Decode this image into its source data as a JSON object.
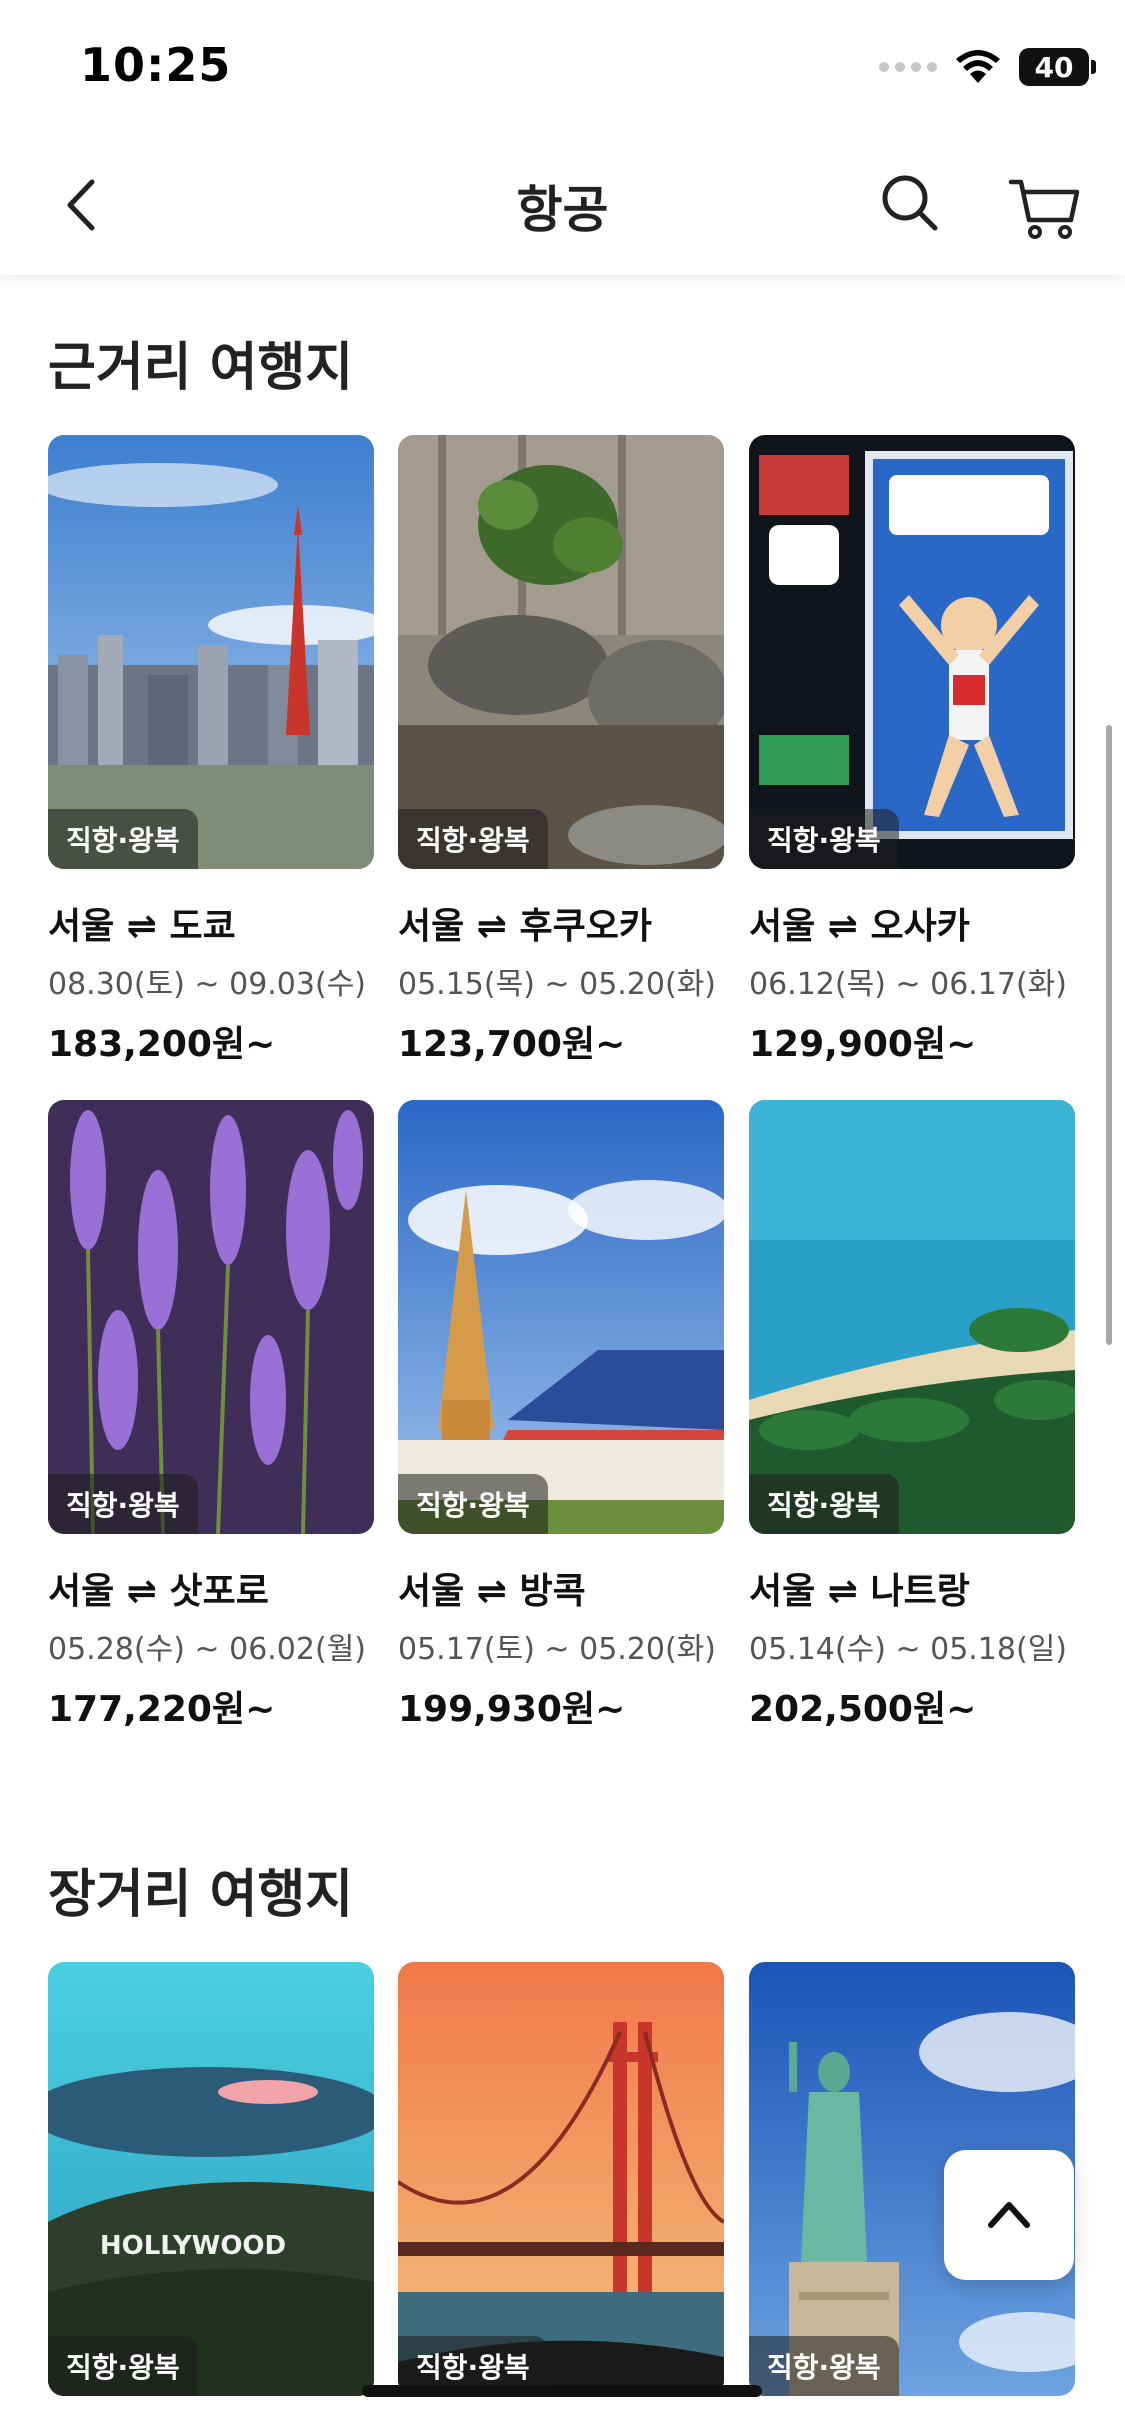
{
  "status_bar": {
    "time": "10:25",
    "battery": "40"
  },
  "header": {
    "title": "항공"
  },
  "sections": [
    {
      "title": "근거리 여행지",
      "cards": [
        {
          "badge": "직항·왕복",
          "route": "서울 ⇌ 도쿄",
          "dates": "08.30(토) ~ 09.03(수)",
          "price": "183,200원~"
        },
        {
          "badge": "직항·왕복",
          "route": "서울 ⇌ 후쿠오카",
          "dates": "05.15(목) ~ 05.20(화)",
          "price": "123,700원~"
        },
        {
          "badge": "직항·왕복",
          "route": "서울 ⇌ 오사카",
          "dates": "06.12(목) ~ 06.17(화)",
          "price": "129,900원~"
        },
        {
          "badge": "직항·왕복",
          "route": "서울 ⇌ 삿포로",
          "dates": "05.28(수) ~ 06.02(월)",
          "price": "177,220원~"
        },
        {
          "badge": "직항·왕복",
          "route": "서울 ⇌ 방콕",
          "dates": "05.17(토) ~ 05.20(화)",
          "price": "199,930원~"
        },
        {
          "badge": "직항·왕복",
          "route": "서울 ⇌ 나트랑",
          "dates": "05.14(수) ~ 05.18(일)",
          "price": "202,500원~"
        }
      ]
    },
    {
      "title": "장거리 여행지",
      "cards": [
        {
          "badge": "직항·왕복"
        },
        {
          "badge": "직항·왕복"
        },
        {
          "badge": "직항·왕복"
        }
      ]
    }
  ],
  "hollywood_sign_text": "HOLLYWOOD"
}
